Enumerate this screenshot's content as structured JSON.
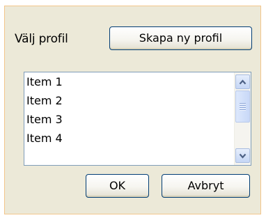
{
  "profile_label": "Välj profil",
  "create_profile_button": "Skapa ny profil",
  "list": {
    "items": [
      "Item 1",
      "Item 2",
      "Item 3",
      "Item 4"
    ]
  },
  "scrollbar": {
    "up_icon": "chevron-up-icon",
    "down_icon": "chevron-down-icon"
  },
  "ok_button": "OK",
  "cancel_button": "Avbryt",
  "colors": {
    "dialog_bg": "#ece9d8",
    "dialog_border": "#f3c58a",
    "button_border": "#003c74",
    "list_border": "#7f9db9",
    "scroll_arrow": "#4d6185"
  }
}
